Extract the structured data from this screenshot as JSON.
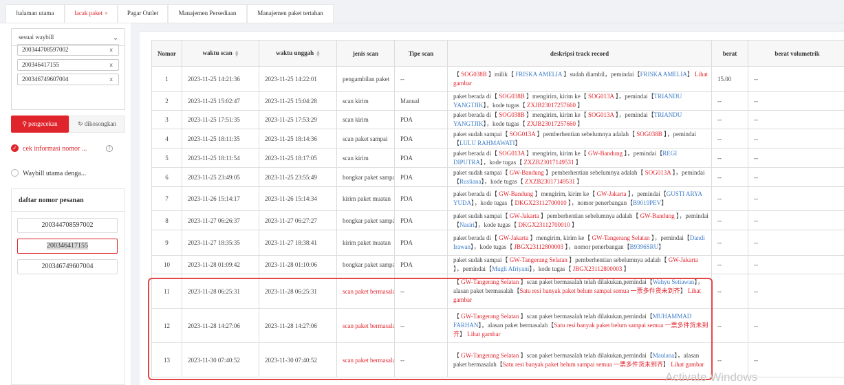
{
  "tabs": [
    {
      "label": "halaman utama",
      "active": false,
      "close": ""
    },
    {
      "label": "lacak paket",
      "active": true,
      "close": "×"
    },
    {
      "label": "Pagar Outlet",
      "active": false,
      "close": ""
    },
    {
      "label": "Manajemen Persediaan",
      "active": false,
      "close": ""
    },
    {
      "label": "Manajemen paket tertahan",
      "active": false,
      "close": ""
    }
  ],
  "sidebar": {
    "select_value": "sesuai waybill",
    "waybills": [
      "200344708597002",
      "200346417155",
      "200346749607004"
    ],
    "search_button": "pengecekan",
    "clear_button": "dikosongkan",
    "search_icon": "search-icon",
    "clear_icon": "refresh-icon",
    "option1": "cek informasi nomor ...",
    "option2": "Waybill utama denga...",
    "orders_title": "daftar nomor pesanan",
    "orders": [
      "200344708597002",
      "200346417155",
      "200346749607004"
    ]
  },
  "table": {
    "headers": [
      "Nomor",
      "waktu scan",
      "waktu unggah",
      "jenis scan",
      "Tipe scan",
      "deskripsi track record",
      "berat",
      "berat volumetrik"
    ],
    "rows": [
      {
        "no": "1",
        "scan": "2023-11-25 14:21:36",
        "upload": "2023-11-25 14:22:01",
        "jenis": "pengambilan paket",
        "tipe": "--",
        "desc": [
          [
            "t",
            "【"
          ],
          [
            "r",
            " SOG038B "
          ],
          [
            "t",
            "】milik【"
          ],
          [
            "b",
            " FRISKA AMELIA "
          ],
          [
            "t",
            "】sudah diambil，pemindai【"
          ],
          [
            "b",
            "FRISKA AMELIA"
          ],
          [
            "t",
            "】 "
          ],
          [
            "r",
            "Lihat gambar"
          ]
        ],
        "berat": "15.00",
        "vol": "--"
      },
      {
        "no": "2",
        "scan": "2023-11-25 15:02:47",
        "upload": "2023-11-25 15:04:28",
        "jenis": "scan kirim",
        "tipe": "Manual",
        "desc": [
          [
            "t",
            "paket berada di【"
          ],
          [
            "r",
            " SOG038B "
          ],
          [
            "t",
            "】mengirim, kirim ke【"
          ],
          [
            "r",
            " SOG013A "
          ],
          [
            "t",
            "】，pemindai【"
          ],
          [
            "b",
            "TRIANDU YANGTJIK"
          ],
          [
            "t",
            "】，kode tugas【"
          ],
          [
            "r",
            " ZXJB23017257660 "
          ],
          [
            "t",
            "】"
          ]
        ],
        "berat": "--",
        "vol": "--"
      },
      {
        "no": "3",
        "scan": "2023-11-25 17:51:35",
        "upload": "2023-11-25 17:53:29",
        "jenis": "scan kirim",
        "tipe": "PDA",
        "desc": [
          [
            "t",
            "paket berada di【"
          ],
          [
            "r",
            " SOG038B "
          ],
          [
            "t",
            "】mengirim, kirim ke【"
          ],
          [
            "r",
            " SOG013A "
          ],
          [
            "t",
            "】，pemindai【"
          ],
          [
            "b",
            "TRIANDU YANGTJIK"
          ],
          [
            "t",
            "】，kode tugas【"
          ],
          [
            "r",
            " ZXJB23017257660 "
          ],
          [
            "t",
            "】"
          ]
        ],
        "berat": "--",
        "vol": "--"
      },
      {
        "no": "4",
        "scan": "2023-11-25 18:11:35",
        "upload": "2023-11-25 18:14:36",
        "jenis": "scan paket sampai",
        "tipe": "PDA",
        "desc": [
          [
            "t",
            "paket sudah sampai【"
          ],
          [
            "r",
            " SOG013A "
          ],
          [
            "t",
            "】pemberhentian sebelumnya adalah【"
          ],
          [
            "r",
            " SOG038B "
          ],
          [
            "t",
            "】，pemindai【"
          ],
          [
            "b",
            "LULU RAHMAWATI"
          ],
          [
            "t",
            "】"
          ]
        ],
        "berat": "--",
        "vol": "--"
      },
      {
        "no": "5",
        "scan": "2023-11-25 18:11:54",
        "upload": "2023-11-25 18:17:05",
        "jenis": "scan kirim",
        "tipe": "PDA",
        "desc": [
          [
            "t",
            "paket berada di【"
          ],
          [
            "r",
            " SOG013A "
          ],
          [
            "t",
            "】mengirim, kirim ke【"
          ],
          [
            "r",
            " GW-Bandung "
          ],
          [
            "t",
            "】，pemindai【"
          ],
          [
            "b",
            "REGI DIPUTRA"
          ],
          [
            "t",
            "】，kode tugas【"
          ],
          [
            "r",
            " ZXZB23017149531 "
          ],
          [
            "t",
            "】"
          ]
        ],
        "berat": "--",
        "vol": "--"
      },
      {
        "no": "6",
        "scan": "2023-11-25 23:49:05",
        "upload": "2023-11-25 23:55:49",
        "jenis": "bongkar paket sampai",
        "tipe": "PDA",
        "desc": [
          [
            "t",
            "paket sudah sampai【"
          ],
          [
            "r",
            " GW-Bandung "
          ],
          [
            "t",
            "】pemberhentian sebelumnya adalah【"
          ],
          [
            "r",
            " SOG013A "
          ],
          [
            "t",
            "】，pemindai【"
          ],
          [
            "b",
            "Rusliana"
          ],
          [
            "t",
            "】，kode tugas【"
          ],
          [
            "r",
            " ZXZB23017149531 "
          ],
          [
            "t",
            "】"
          ]
        ],
        "berat": "--",
        "vol": "--"
      },
      {
        "no": "7",
        "scan": "2023-11-26 15:14:17",
        "upload": "2023-11-26 15:14:34",
        "jenis": "kirim paket muatan",
        "tipe": "PDA",
        "desc": [
          [
            "t",
            "paket berada di【"
          ],
          [
            "r",
            " GW-Bandung "
          ],
          [
            "t",
            "】mengirim, kirim ke【"
          ],
          [
            "r",
            " GW-Jakarta "
          ],
          [
            "t",
            "】，pemindai【"
          ],
          [
            "b",
            "GUSTI ARYA YUDA"
          ],
          [
            "t",
            "】，kode tugas【"
          ],
          [
            "r",
            " DKGX23112700010 "
          ],
          [
            "t",
            "】，nomor penerbangan【"
          ],
          [
            "b",
            "B9019PEV"
          ],
          [
            "t",
            "】"
          ]
        ],
        "berat": "--",
        "vol": "--"
      },
      {
        "no": "8",
        "scan": "2023-11-27 06:26:37",
        "upload": "2023-11-27 06:27:27",
        "jenis": "bongkar paket sampai",
        "tipe": "PDA",
        "desc": [
          [
            "t",
            "paket sudah sampai【"
          ],
          [
            "r",
            " GW-Jakarta "
          ],
          [
            "t",
            "】pemberhentian sebelumnya adalah【"
          ],
          [
            "r",
            " GW-Bandung "
          ],
          [
            "t",
            "】，pemindai【"
          ],
          [
            "b",
            "Nasiri"
          ],
          [
            "t",
            "】，kode tugas【"
          ],
          [
            "r",
            " DKGX23112700010 "
          ],
          [
            "t",
            "】"
          ]
        ],
        "berat": "--",
        "vol": "--"
      },
      {
        "no": "9",
        "scan": "2023-11-27 18:35:35",
        "upload": "2023-11-27 18:38:41",
        "jenis": "kirim paket muatan",
        "tipe": "PDA",
        "desc": [
          [
            "t",
            "paket berada di【"
          ],
          [
            "r",
            " GW-Jakarta "
          ],
          [
            "t",
            "】mengirim, kirim ke【"
          ],
          [
            "r",
            " GW-Tangerang Selatan "
          ],
          [
            "t",
            "】，pemindai【"
          ],
          [
            "b",
            "Dandi Irawan"
          ],
          [
            "t",
            "】，kode tugas【"
          ],
          [
            "r",
            " JBGX23112800003 "
          ],
          [
            "t",
            "】，nomor penerbangan【"
          ],
          [
            "b",
            "B9396SRU"
          ],
          [
            "t",
            "】"
          ]
        ],
        "berat": "--",
        "vol": "--"
      },
      {
        "no": "10",
        "scan": "2023-11-28 01:09:42",
        "upload": "2023-11-28 01:10:06",
        "jenis": "bongkar paket sampai",
        "tipe": "PDA",
        "desc": [
          [
            "t",
            "paket sudah sampai【"
          ],
          [
            "r",
            " GW-Tangerang Selatan "
          ],
          [
            "t",
            "】pemberhentian sebelumnya adalah【"
          ],
          [
            "r",
            " GW-Jakarta "
          ],
          [
            "t",
            "】，pemindai【"
          ],
          [
            "b",
            "Mugli Afriyani"
          ],
          [
            "t",
            "】，kode tugas【"
          ],
          [
            "r",
            " JBGX23112800003 "
          ],
          [
            "t",
            "】"
          ]
        ],
        "berat": "--",
        "vol": "--"
      },
      {
        "no": "11",
        "scan": "2023-11-28 06:25:31",
        "upload": "2023-11-28 06:25:31",
        "jenis": "scan paket bermasalah",
        "tipe": "--",
        "desc": [
          [
            "t",
            "【"
          ],
          [
            "r",
            " GW-Tangerang Selatan "
          ],
          [
            "t",
            "】scan paket bermasalah telah dilakukan,pemindai【"
          ],
          [
            "b",
            "Wahyu Setiawan"
          ],
          [
            "t",
            "】，alasan paket bermasalah【"
          ],
          [
            "r",
            "Satu resi banyak paket belum sampai semua 一票多件货未到齐"
          ],
          [
            "t",
            "】 "
          ],
          [
            "r",
            "Lihat gambar"
          ]
        ],
        "berat": "--",
        "vol": "--"
      },
      {
        "no": "12",
        "scan": "2023-11-28 14:27:06",
        "upload": "2023-11-28 14:27:06",
        "jenis": "scan paket bermasalah",
        "tipe": "--",
        "desc": [
          [
            "t",
            "【"
          ],
          [
            "r",
            " GW-Tangerang Selatan "
          ],
          [
            "t",
            "】scan paket bermasalah telah dilakukan,pemindai【"
          ],
          [
            "b",
            "MUHAMMAD FARHAN"
          ],
          [
            "t",
            "】，alasan paket bermasalah【"
          ],
          [
            "r",
            "Satu resi banyak paket belum sampai semua 一票多件货未到齐"
          ],
          [
            "t",
            "】 "
          ],
          [
            "r",
            "Lihat gambar"
          ]
        ],
        "berat": "--",
        "vol": "--"
      },
      {
        "no": "13",
        "scan": "2023-11-30 07:40:52",
        "upload": "2023-11-30 07:40:52",
        "jenis": "scan paket bermasalah",
        "tipe": "--",
        "desc": [
          [
            "t",
            "【"
          ],
          [
            "r",
            " GW-Tangerang Selatan "
          ],
          [
            "t",
            "】scan paket bermasalah telah dilakukan,pemindai【"
          ],
          [
            "b",
            "Maulana"
          ],
          [
            "t",
            "】，alasan paket bermasalah【"
          ],
          [
            "r",
            "Satu resi banyak paket belum sampai semua 一票多件货未到齐"
          ],
          [
            "t",
            "】 "
          ],
          [
            "r",
            "Lihat gambar"
          ]
        ],
        "berat": "--",
        "vol": "--"
      }
    ]
  },
  "watermark": "Activate Windows",
  "colors": {
    "accent": "#e0242c",
    "link": "#3e7cc8",
    "highlight_border": "#e54545"
  }
}
